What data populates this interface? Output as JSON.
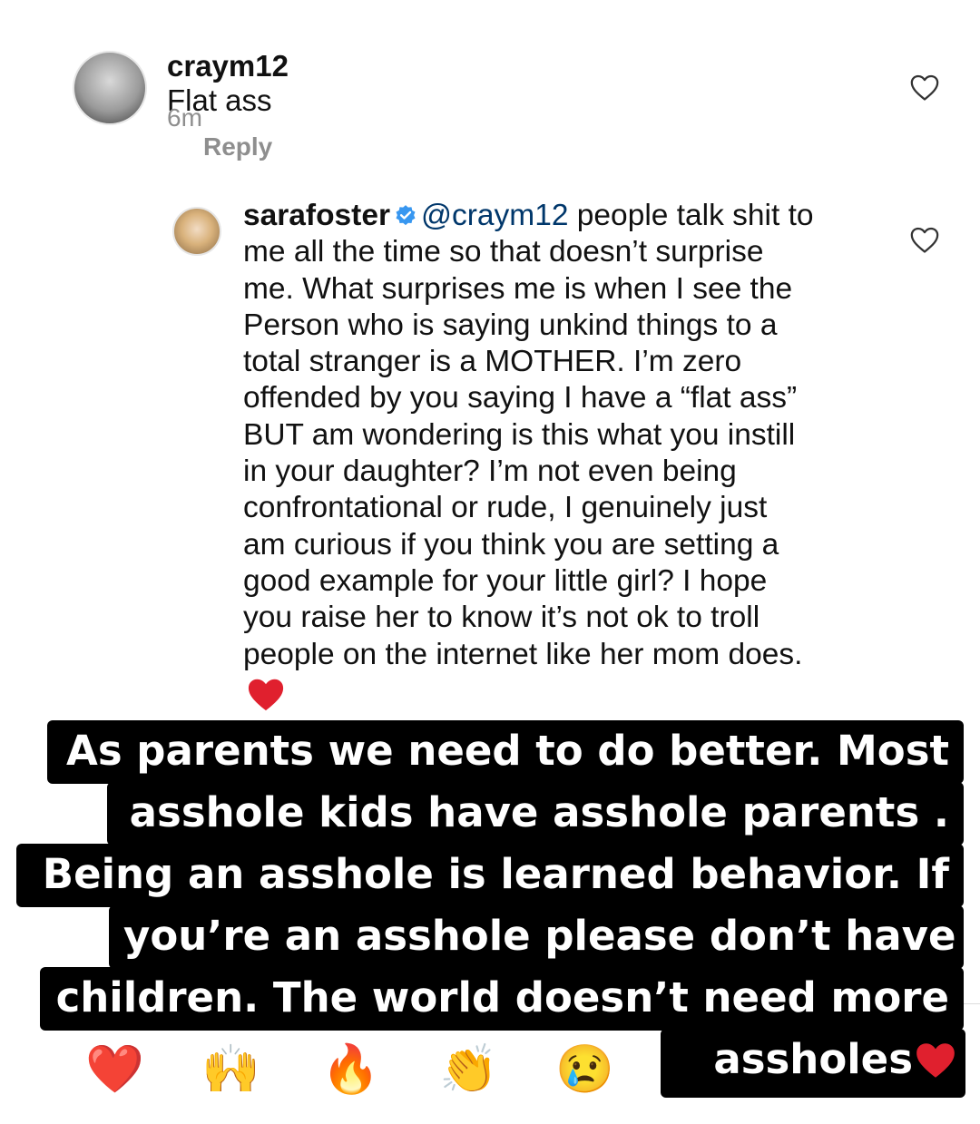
{
  "comment1": {
    "username": "craym12",
    "text": "Flat ass",
    "time": "6m",
    "reply_label": "Reply"
  },
  "comment2": {
    "username": "sarafoster",
    "mention": "@craym12",
    "text_first": "people talk shit to",
    "text_rest": "me all the time so that doesn’t surprise\nme. What surprises me is when I see the\nPerson who is saying unkind things to a\ntotal stranger is a MOTHER. I’m zero\noffended by you saying I have a “flat ass”\nBUT am wondering is this what you instill\nin your daughter? I’m not even being\nconfrontational or rude, I genuinely just\nam curious if you think you are setting a\ngood example for your little girl? I hope\nyou raise her to know it’s not ok to troll\npeople on the internet like her mom does."
  },
  "overlay": {
    "line1": "As parents we need to do better.  Most",
    "line2": "asshole  kids have asshole parents .",
    "line3": "Being  an  asshole is learned behavior. If",
    "line4": "you’re an asshole please don’t have",
    "line5": "children. The world doesn’t need more",
    "line6": "assholes"
  },
  "emojis": [
    "❤️",
    "🙌",
    "🔥",
    "👏",
    "😢"
  ],
  "icons": {
    "like_heart_outline": "heart-outline-icon",
    "verified_badge": "verified-badge-icon",
    "red_heart": "red-heart-icon"
  },
  "colors": {
    "verified": "#3897f0",
    "mention": "#00376b",
    "meta": "#8e8e8e",
    "heart": "#e0202e"
  }
}
